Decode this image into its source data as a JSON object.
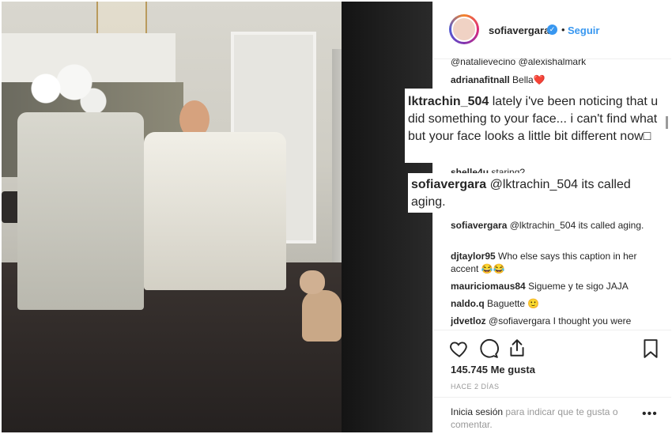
{
  "header": {
    "username": "sofiavergara",
    "verified_label": "✓",
    "separator": "•",
    "follow_label": "Seguir"
  },
  "overlays": {
    "comment1": {
      "username": "lktrachin_504",
      "text": "lately i've been noticing that u did something to your face... i can't find what but your face looks a little bit different now□"
    },
    "comment2": {
      "username": "sofiavergara",
      "text": "@lktrachin_504 its called aging."
    }
  },
  "comments": [
    {
      "username": "",
      "text": "@natalievecino @alexishalmark"
    },
    {
      "username": "adrianafitnall",
      "text": "Bella❤️"
    },
    {
      "username": "shelle4u",
      "text": "staring?"
    },
    {
      "username": "sofiavergara",
      "text": "@lktrachin_504 its called aging."
    },
    {
      "username": "djtaylor95",
      "text": "Who else says this caption in her accent 😂😂"
    },
    {
      "username": "mauriciomaus84",
      "text": "Sigueme y te sigo JAJA"
    },
    {
      "username": "naldo.q",
      "text": "Baguette 🙂"
    },
    {
      "username": "jdvetloz",
      "text": "@sofiavergara I thought you were"
    }
  ],
  "actions": {
    "likes": "145.745 Me gusta",
    "time_ago": "HACE 2 DÍAS",
    "login_link": "Inicia sesión",
    "login_text": "para indicar que te gusta o comentar.",
    "more_label": "•••"
  },
  "icons": [
    "heart-icon",
    "comment-icon",
    "share-icon",
    "bookmark-icon"
  ],
  "colors": {
    "link": "#3897f0",
    "text": "#262626",
    "muted": "#999999"
  }
}
